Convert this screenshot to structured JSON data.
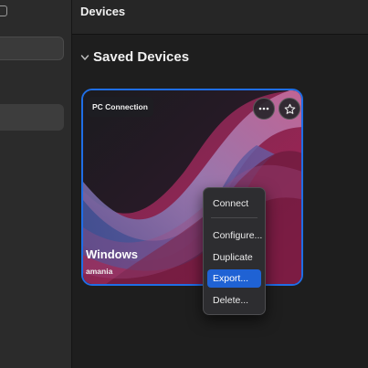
{
  "header": {
    "title": "Devices"
  },
  "section": {
    "title": "Saved Devices"
  },
  "card": {
    "badge": "PC Connection",
    "name": "Windows",
    "user": "amania",
    "accent": "#1f6ee6"
  },
  "context_menu": {
    "items": [
      {
        "label": "Connect"
      },
      {
        "label": "Configure..."
      },
      {
        "label": "Duplicate"
      },
      {
        "label": "Export...",
        "highlighted": true
      },
      {
        "label": "Delete..."
      }
    ],
    "highlight_color": "#1f62d4"
  },
  "icons": [
    "chevron-down-icon",
    "ellipsis-icon",
    "star-icon"
  ]
}
